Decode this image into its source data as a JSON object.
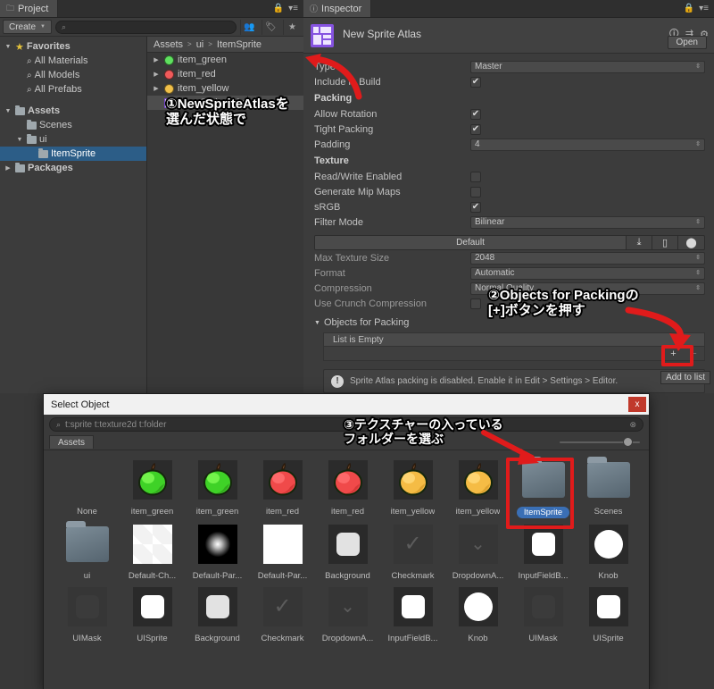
{
  "project_panel": {
    "tab_label": "Project",
    "tab_icon": "folder-icon",
    "lock_icon": "lock-icon",
    "menu_icon": "hamburger-menu-icon",
    "create_button": "Create",
    "search_placeholder": "",
    "search_value": "",
    "toolbar_icons": [
      "people-icon",
      "label-icon",
      "favorite-star-icon"
    ],
    "tree": [
      {
        "label": "Favorites",
        "icon": "star-icon",
        "indent": 0,
        "arrow": "▼",
        "bold": true,
        "selected": false
      },
      {
        "label": "All Materials",
        "icon": "search-icon",
        "indent": 1,
        "arrow": "",
        "bold": false,
        "selected": false
      },
      {
        "label": "All Models",
        "icon": "search-icon",
        "indent": 1,
        "arrow": "",
        "bold": false,
        "selected": false
      },
      {
        "label": "All Prefabs",
        "icon": "search-icon",
        "indent": 1,
        "arrow": "",
        "bold": false,
        "selected": false
      },
      {
        "label": "",
        "icon": "",
        "indent": 0,
        "arrow": "",
        "bold": false,
        "selected": false
      },
      {
        "label": "Assets",
        "icon": "folder-icon",
        "indent": 0,
        "arrow": "▼",
        "bold": true,
        "selected": false
      },
      {
        "label": "Scenes",
        "icon": "folder-icon",
        "indent": 1,
        "arrow": "",
        "bold": false,
        "selected": false
      },
      {
        "label": "ui",
        "icon": "folder-icon",
        "indent": 1,
        "arrow": "▼",
        "bold": false,
        "selected": false
      },
      {
        "label": "ItemSprite",
        "icon": "folder-icon",
        "indent": 2,
        "arrow": "",
        "bold": false,
        "selected": true
      },
      {
        "label": "Packages",
        "icon": "folder-icon",
        "indent": 0,
        "arrow": "▶",
        "bold": true,
        "selected": false
      }
    ],
    "breadcrumb": [
      "Assets",
      "ui",
      "ItemSprite"
    ],
    "assets": [
      {
        "label": "item_green",
        "icon": "sprite-icon",
        "color": "#5fe05f",
        "arrow": "▶",
        "selected": false
      },
      {
        "label": "item_red",
        "icon": "sprite-icon",
        "color": "#f05a5a",
        "arrow": "▶",
        "selected": false
      },
      {
        "label": "item_yellow",
        "icon": "sprite-icon",
        "color": "#f0c04a",
        "arrow": "▶",
        "selected": false
      },
      {
        "label": "New Sprite Atlas",
        "icon": "sprite-atlas-icon",
        "color": "#8653e0",
        "arrow": "",
        "selected": true
      }
    ]
  },
  "inspector": {
    "tab_label": "Inspector",
    "tab_icon": "info-icon",
    "lock_icon": "lock-icon",
    "menu_icon": "hamburger-menu-icon",
    "asset_name": "New Sprite Atlas",
    "asset_icon": "sprite-atlas-icon",
    "header_icons": [
      "help-icon",
      "preset-icon",
      "gear-icon"
    ],
    "open_button": "Open",
    "properties": [
      {
        "label": "Type",
        "control": "dropdown",
        "value": "Master"
      },
      {
        "label": "Include in Build",
        "control": "checkbox",
        "value": true
      }
    ],
    "packing_section": {
      "title": "Packing",
      "properties": [
        {
          "label": "Allow Rotation",
          "control": "checkbox",
          "value": true
        },
        {
          "label": "Tight Packing",
          "control": "checkbox",
          "value": true
        },
        {
          "label": "Padding",
          "control": "dropdown",
          "value": "4"
        }
      ]
    },
    "texture_section": {
      "title": "Texture",
      "properties": [
        {
          "label": "Read/Write Enabled",
          "control": "checkbox",
          "value": false
        },
        {
          "label": "Generate Mip Maps",
          "control": "checkbox",
          "value": false
        },
        {
          "label": "sRGB",
          "control": "checkbox",
          "value": true
        },
        {
          "label": "Filter Mode",
          "control": "dropdown",
          "value": "Bilinear"
        }
      ]
    },
    "platform_bar": {
      "active_tab": "Default",
      "tabs": [
        "desktop-icon",
        "ios-icon",
        "android-icon"
      ]
    },
    "platform_properties": [
      {
        "label": "Max Texture Size",
        "control": "dropdown",
        "value": "2048"
      },
      {
        "label": "Format",
        "control": "dropdown",
        "value": "Automatic"
      },
      {
        "label": "Compression",
        "control": "dropdown",
        "value": "Normal Quality"
      },
      {
        "label": "Use Crunch Compression",
        "control": "checkbox",
        "value": false
      }
    ],
    "objects_for_packing": {
      "title": "Objects for Packing",
      "foldout_arrow": "▼",
      "empty_message": "List is Empty",
      "add_button": "+",
      "remove_button": "−"
    },
    "warning": {
      "icon": "warning-icon",
      "text": "Sprite Atlas packing is disabled. Enable it in Edit > Settings > Editor."
    },
    "tooltip": "Add to list"
  },
  "select_dialog": {
    "title": "Select Object",
    "close_label": "x",
    "search_icon": "search-icon",
    "search_value": "t:sprite t:texture2d t:folder",
    "clear_icon": "clear-icon",
    "tab_label": "Assets",
    "zoom_slider_value": 78,
    "rows": [
      [
        {
          "label": "None",
          "thumb": "none"
        },
        {
          "label": "item_green",
          "thumb": "apple-green"
        },
        {
          "label": "item_green",
          "thumb": "apple-green"
        },
        {
          "label": "item_red",
          "thumb": "apple-red"
        },
        {
          "label": "item_red",
          "thumb": "apple-red"
        },
        {
          "label": "item_yellow",
          "thumb": "apple-yellow"
        },
        {
          "label": "item_yellow",
          "thumb": "apple-yellow"
        },
        {
          "label": "ItemSprite",
          "thumb": "folder",
          "selected": true
        },
        {
          "label": "Scenes",
          "thumb": "folder"
        }
      ],
      [
        {
          "label": "ui",
          "thumb": "folder"
        },
        {
          "label": "Default-Ch...",
          "thumb": "checkerboard"
        },
        {
          "label": "Default-Par...",
          "thumb": "radial-black"
        },
        {
          "label": "Default-Par...",
          "thumb": "white-square"
        },
        {
          "label": "Background",
          "thumb": "rounded-light"
        },
        {
          "label": "Checkmark",
          "thumb": "checkmark-glyph"
        },
        {
          "label": "DropdownA...",
          "thumb": "chevron-glyph"
        },
        {
          "label": "InputFieldB...",
          "thumb": "rounded-white"
        },
        {
          "label": "Knob",
          "thumb": "circle-white"
        }
      ],
      [
        {
          "label": "UIMask",
          "thumb": "rounded-dark"
        },
        {
          "label": "UISprite",
          "thumb": "rounded-white"
        },
        {
          "label": "Background",
          "thumb": "rounded-light"
        },
        {
          "label": "Checkmark",
          "thumb": "checkmark-glyph"
        },
        {
          "label": "DropdownA...",
          "thumb": "chevron-glyph"
        },
        {
          "label": "InputFieldB...",
          "thumb": "rounded-white"
        },
        {
          "label": "Knob",
          "thumb": "circle-white"
        },
        {
          "label": "UIMask",
          "thumb": "rounded-dark"
        },
        {
          "label": "UISprite",
          "thumb": "rounded-white"
        }
      ]
    ]
  },
  "annotations": {
    "step1": "①NewSpriteAtlasを\n選んだ状態で",
    "step2": "②Objects for Packingの\n[+]ボタンを押す",
    "step3": "③テクスチャーの入っている\nフォルダーを選ぶ",
    "highlight_color": "#e01b1b"
  }
}
